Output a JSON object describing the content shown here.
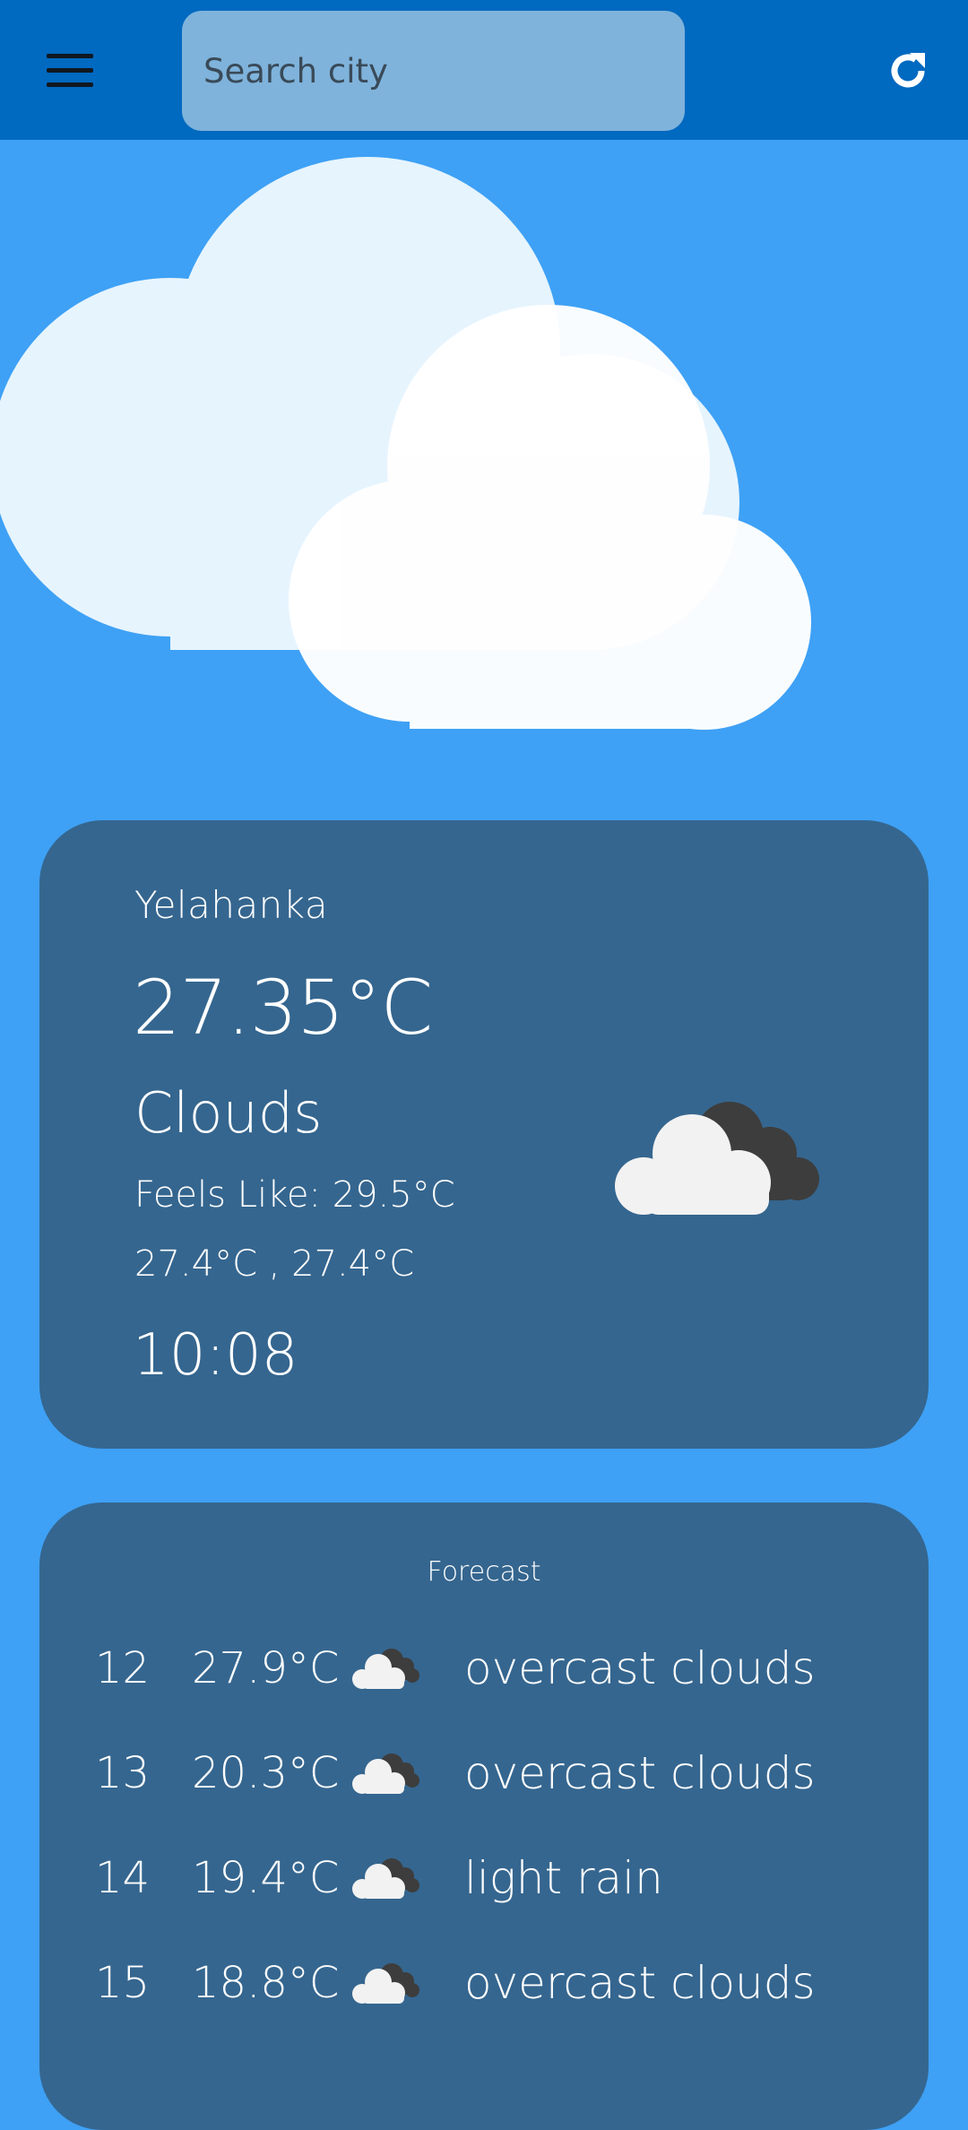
{
  "header": {
    "menu_icon": "hamburger-menu-icon",
    "search": {
      "placeholder": "Search city",
      "value": ""
    },
    "refresh_icon": "refresh-icon",
    "bar_color": "#0069c0"
  },
  "hero": {
    "icon": "large-clouds-illustration"
  },
  "current": {
    "city": "Yelahanka",
    "temperature": "27.35°C",
    "condition": "Clouds",
    "feels_like": "Feels Like: 29.5°C",
    "min_max": "27.4°C , 27.4°C",
    "time": "10:08",
    "icon": "broken-clouds-icon"
  },
  "forecast": {
    "title": "Forecast",
    "items": [
      {
        "day": "12",
        "temp": "27.9°C",
        "icon": "broken-clouds-icon",
        "desc": "overcast clouds"
      },
      {
        "day": "13",
        "temp": "20.3°C",
        "icon": "broken-clouds-icon",
        "desc": "overcast clouds"
      },
      {
        "day": "14",
        "temp": "19.4°C",
        "icon": "broken-clouds-icon",
        "desc": "light rain"
      },
      {
        "day": "15",
        "temp": "18.8°C",
        "icon": "broken-clouds-icon",
        "desc": "overcast clouds"
      }
    ]
  },
  "colors": {
    "background": "#3ea1f5",
    "card": "#35668f"
  }
}
